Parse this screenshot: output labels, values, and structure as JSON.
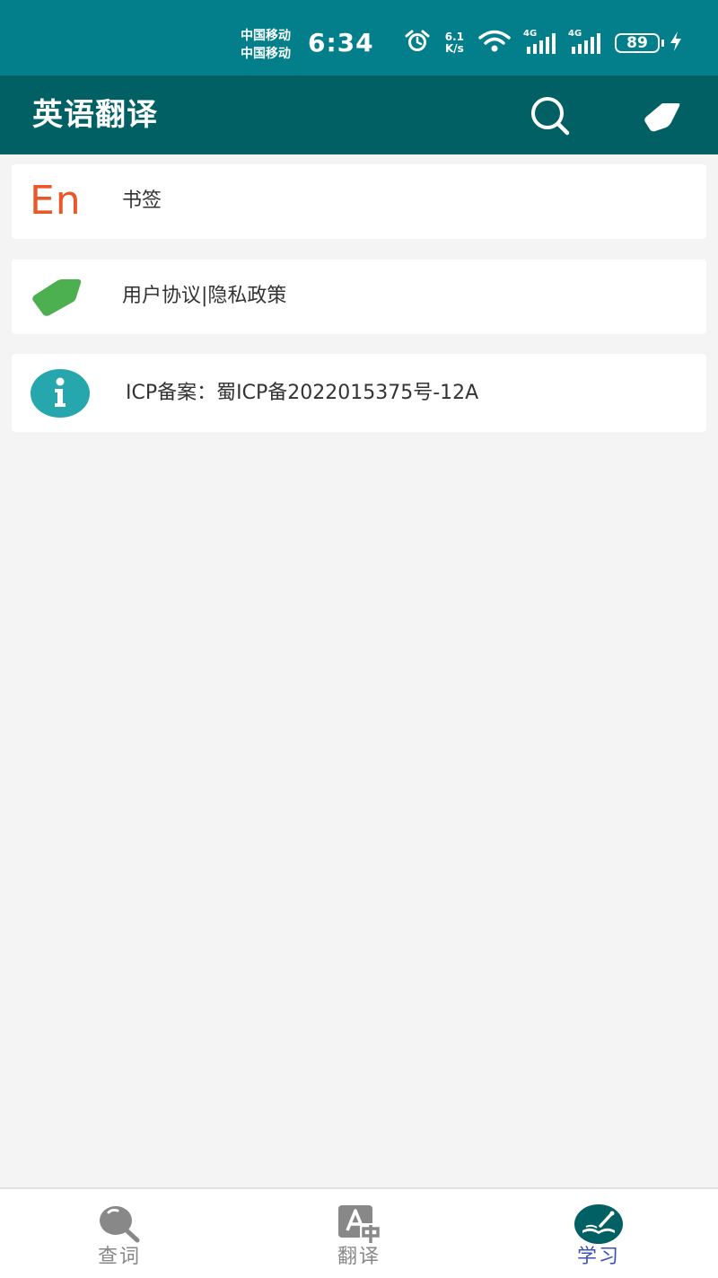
{
  "status_bar": {
    "carrier_1": "中国移动",
    "carrier_2": "中国移动",
    "time": "6:34",
    "net_speed_value": "6.1",
    "net_speed_unit": "K/s",
    "signal_1_tag": "4G",
    "signal_2_tag": "4G",
    "battery_level": "89"
  },
  "app_bar": {
    "title": "英语翻译",
    "search_icon": "search-icon",
    "tag_icon": "tag-icon",
    "background_color": "#006064"
  },
  "list": {
    "items": [
      {
        "icon_text": "En",
        "icon": "en-logo-icon",
        "label": "书签"
      },
      {
        "icon": "tag-icon",
        "label": "用户协议|隐私政策"
      },
      {
        "icon": "info-icon",
        "label": "ICP备案：蜀ICP备2022015375号-12A"
      }
    ]
  },
  "bottom_nav": {
    "items": [
      {
        "label": "查词",
        "icon": "search-icon",
        "active": false
      },
      {
        "label": "翻译",
        "icon": "translate-icon",
        "active": false
      },
      {
        "label": "学习",
        "icon": "study-book-icon",
        "active": true
      }
    ],
    "active_color": "#3f51b5",
    "inactive_color": "#888888"
  },
  "colors": {
    "status_bar": "#027f8a",
    "en_logo": "#e8582b",
    "tag_green": "#4caf50",
    "info_teal": "#26a6ad"
  }
}
